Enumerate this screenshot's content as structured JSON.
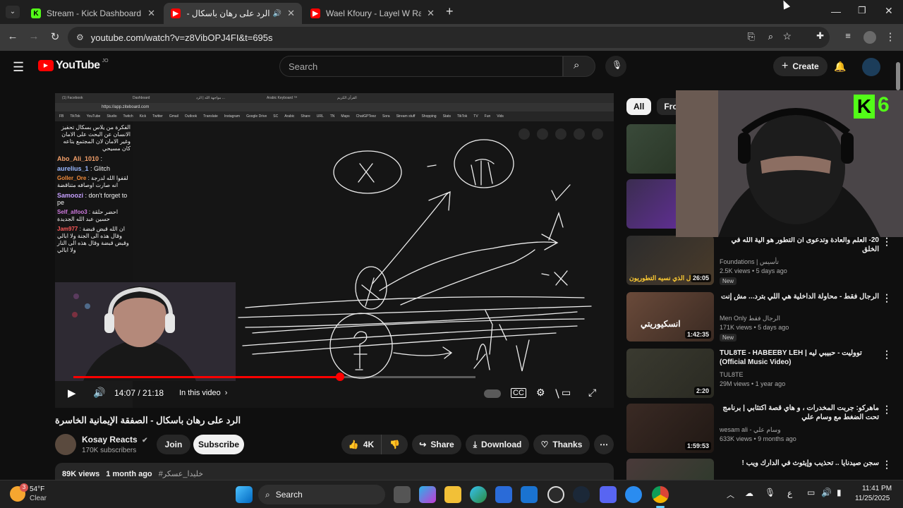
{
  "browser": {
    "tabs": [
      {
        "title": "Stream - Kick Dashboard",
        "active": false
      },
      {
        "title": "الرد على رهان باسكال - الصفقة",
        "active": true
      },
      {
        "title": "Wael Kfoury - Layel W Raad | ليل",
        "active": false
      }
    ],
    "url": "youtube.com/watch?v=z8VibOPJ4FI&t=695s"
  },
  "youtube": {
    "logo_text": "YouTube",
    "country_code": "JO",
    "search_placeholder": "Search",
    "create_label": "Create"
  },
  "video": {
    "inner_url": "https://app.ziteboard.com",
    "inner_bookmarks": [
      "FB",
      "TikTok",
      "YouTube",
      "Studio",
      "Twitch",
      "Kick",
      "Twitter",
      "Gmail",
      "Outlook",
      "Translate",
      "Instagram",
      "Google Drive",
      "SC",
      "Arabic",
      "Share",
      "URL",
      "TN",
      "Maps",
      "ChatGPTeez",
      "Sora",
      "Stream stuff",
      "Shopping",
      "Stats",
      "TikTok",
      "TV",
      "Fun",
      "Vids"
    ],
    "inner_tabs": [
      "(1) Facebook",
      "Dashboard",
      "مواجهة الله | الرد ...",
      "Arabic Keyboard ™",
      "القرآن الكريم"
    ],
    "chat": [
      {
        "user": "",
        "text": "الفكرة من يلاس بسكال تحفيز الانسان عن البحث على الامان وغير الامان لان المجتمع بتاعه كان مسيحي"
      },
      {
        "user": "Abo_Ali_1010",
        "text": ":"
      },
      {
        "user": "aurelius_1",
        "text": ": Glitch"
      },
      {
        "user": "Goller_Ore",
        "text": ": لقفوا الله لدرجة انه صارت اوصافه متناقضة"
      },
      {
        "user": "Samoozi",
        "text": ": don't forget to pe"
      },
      {
        "user": "Self_alfoo3",
        "text": ": احضر حلقة حسين عبد الله الجديدة"
      },
      {
        "user": "Jam977",
        "text": ": ان الله قبض قبضة وقال هذه الى الجنة ولا ابالي وقبض قبضة وقال هذه الى النار ولا ابالي"
      }
    ],
    "time": "14:07 / 21:18",
    "progress": 0.6628,
    "in_this_video": "In this video",
    "title": "الرد على رهان باسكال - الصفقة الإيمانية الخاسرة",
    "channel": "Kosay Reacts",
    "subscribers": "170K subscribers",
    "join_label": "Join",
    "subscribe_label": "Subscribe",
    "likes": "4K",
    "share_label": "Share",
    "download_label": "Download",
    "thanks_label": "Thanks",
    "views": "89K views",
    "age": "1 month ago",
    "hashtag": "#خليدا_عسكر"
  },
  "sidebar": {
    "chips": [
      "All",
      "From"
    ],
    "recs": [
      {
        "title": "",
        "channel": "",
        "meta": "",
        "duration": ""
      },
      {
        "title": "",
        "channel": "",
        "meta": "",
        "duration": ""
      },
      {
        "title": "20- العلم والعادة وتدعوى ان التطور هو الية الله في الخلق",
        "channel": "Foundations | تأسيس",
        "meta": "2.5K views • 5 days ago",
        "badge": "New",
        "duration": "26:05",
        "thumb_text": "ال الذي نسيه التطوريون"
      },
      {
        "title": "الرجال فقط - محاولة الداخلية هي اللي بترد... مش إنت",
        "channel": "Men Only الرجال فقط",
        "meta": "171K views • 5 days ago",
        "badge": "New",
        "duration": "1:42:35",
        "thumb_text": "انسكيوريتي"
      },
      {
        "title": "TUL8TE - HABEEBY LEH | تووليت - حبيبي ليه (Official Music Video)",
        "channel": "TUL8TE",
        "meta": "29M views • 1 year ago",
        "duration": "2:20"
      },
      {
        "title": "ماهركو: جربت المخدرات ، و هاي قصة اكتئابي | برنامج تحت الضغط مع وسام علي",
        "channel": "wesam ali - وسام علي",
        "meta": "633K views • 9 months ago",
        "duration": "1:59:53"
      },
      {
        "title": "سجن صيدنايا .. تحذيب وإيثوث في الدارك ويب !",
        "channel": "",
        "meta": "",
        "duration": ""
      }
    ]
  },
  "overlay": {
    "kick_text": "6"
  },
  "taskbar": {
    "temp": "54°F",
    "weather": "Clear",
    "weather_badge": "3",
    "search_label": "Search",
    "lang": "ع",
    "time": "11:41 PM",
    "date": "11/25/2025"
  },
  "colors": {
    "youtube_red": "#ff0000",
    "kick_green": "#53fc18",
    "bg": "#0f0f0f"
  }
}
